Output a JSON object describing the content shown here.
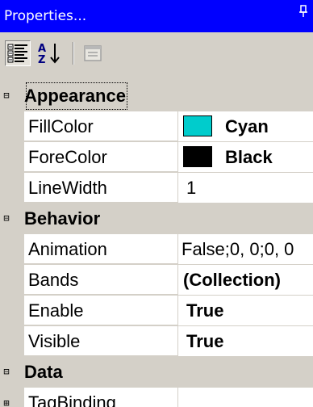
{
  "window": {
    "title": "Properties...",
    "pin_icon": "pin-icon",
    "title_bg": "#0000ff"
  },
  "toolbar": {
    "categorized_icon": "categorized-icon",
    "alphabetical_icon": "alphabetical-sort-icon",
    "property_pages_icon": "property-pages-icon"
  },
  "categories": {
    "appearance": "Appearance",
    "behavior": "Behavior",
    "data": "Data"
  },
  "properties": {
    "fillcolor": {
      "name": "FillColor",
      "value": "Cyan",
      "swatch": "#00cccc"
    },
    "forecolor": {
      "name": "ForeColor",
      "value": "Black",
      "swatch": "#000000"
    },
    "linewidth": {
      "name": "LineWidth",
      "value": "1"
    },
    "animation": {
      "name": "Animation",
      "value": "False;0, 0;0, 0"
    },
    "bands": {
      "name": "Bands",
      "value": "(Collection)"
    },
    "enable": {
      "name": "Enable",
      "value": "True"
    },
    "visible": {
      "name": "Visible",
      "value": "True"
    },
    "tagbinding": {
      "name": "TagBinding",
      "value": ""
    }
  },
  "expanders": {
    "collapse": "⊟",
    "expand": "⊞"
  }
}
